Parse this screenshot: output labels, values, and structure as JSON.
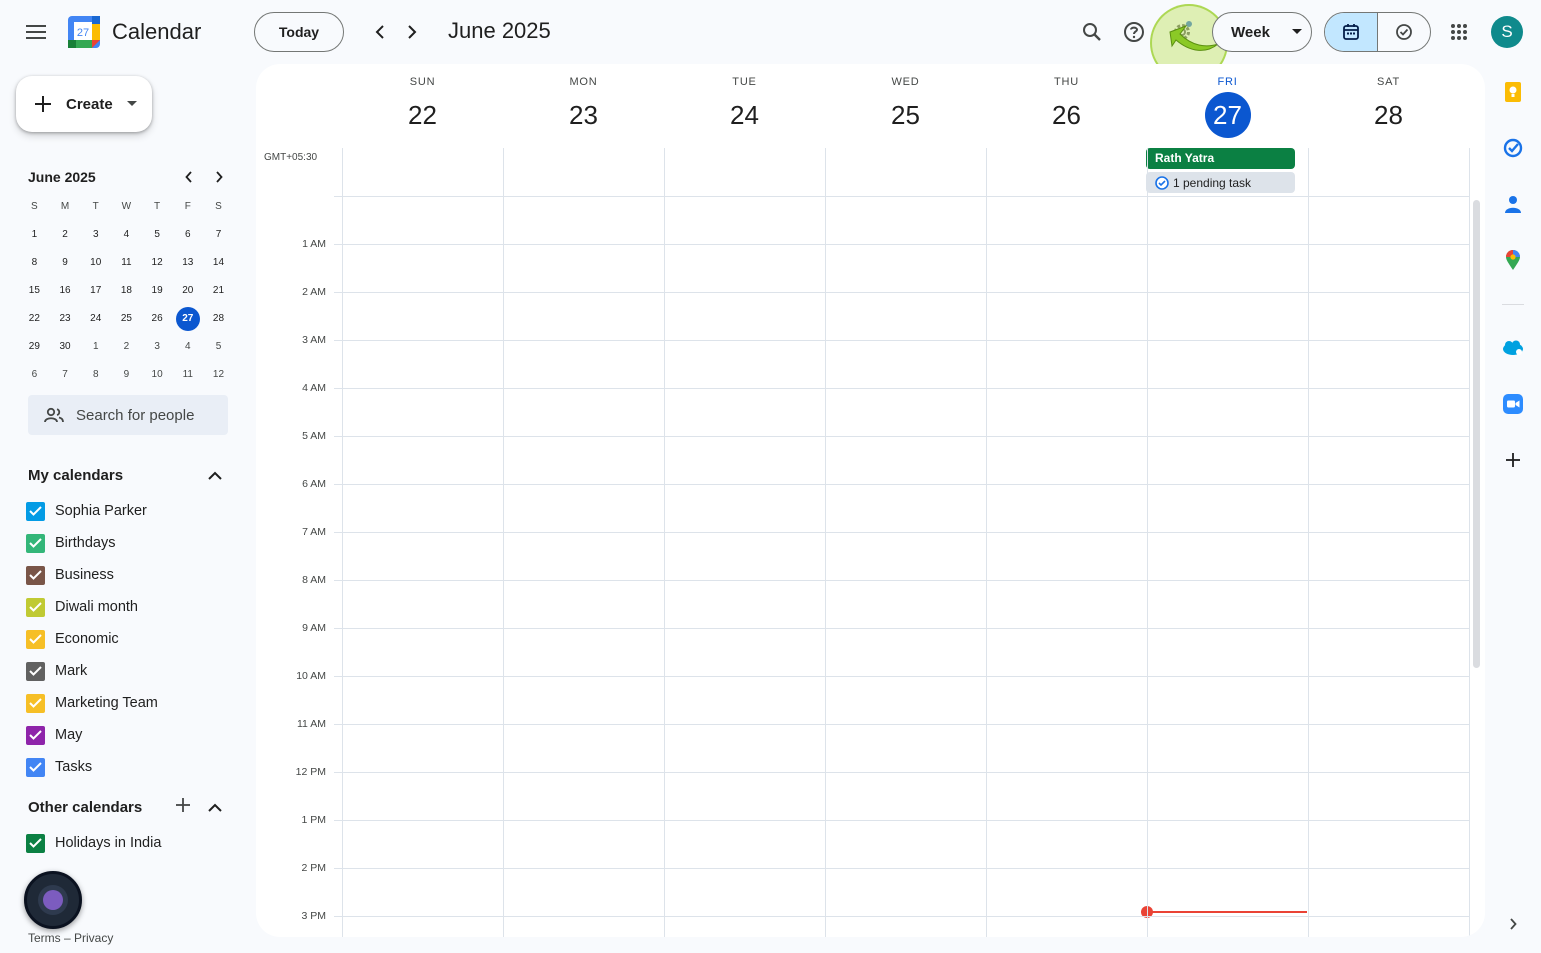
{
  "header": {
    "app_title": "Calendar",
    "logo_day": "27",
    "today_label": "Today",
    "month_title": "June 2025",
    "view_label": "Week",
    "avatar_letter": "S"
  },
  "sidebar": {
    "create_label": "Create",
    "mini_calendar": {
      "title": "June 2025",
      "weekdays": [
        "S",
        "M",
        "T",
        "W",
        "T",
        "F",
        "S"
      ],
      "weeks": [
        [
          "1",
          "2",
          "3",
          "4",
          "5",
          "6",
          "7"
        ],
        [
          "8",
          "9",
          "10",
          "11",
          "12",
          "13",
          "14"
        ],
        [
          "15",
          "16",
          "17",
          "18",
          "19",
          "20",
          "21"
        ],
        [
          "22",
          "23",
          "24",
          "25",
          "26",
          "27",
          "28"
        ],
        [
          "29",
          "30",
          "1",
          "2",
          "3",
          "4",
          "5"
        ],
        [
          "6",
          "7",
          "8",
          "9",
          "10",
          "11",
          "12"
        ]
      ],
      "today": "27"
    },
    "search_people_placeholder": "Search for people",
    "my_calendars_title": "My calendars",
    "my_calendars": [
      {
        "label": "Sophia Parker",
        "color": "#039be5"
      },
      {
        "label": "Birthdays",
        "color": "#33b679"
      },
      {
        "label": "Business",
        "color": "#795548"
      },
      {
        "label": "Diwali month",
        "color": "#c0ca33"
      },
      {
        "label": "Economic",
        "color": "#f6bf26"
      },
      {
        "label": "Mark",
        "color": "#616161"
      },
      {
        "label": "Marketing Team",
        "color": "#f6bf26"
      },
      {
        "label": "May",
        "color": "#8e24aa"
      },
      {
        "label": "Tasks",
        "color": "#4285f4"
      }
    ],
    "other_calendars_title": "Other calendars",
    "other_calendars": [
      {
        "label": "Holidays in India",
        "color": "#0b8043"
      }
    ],
    "footer": "Terms – Privacy"
  },
  "week": {
    "timezone": "GMT+05:30",
    "days": [
      {
        "name": "SUN",
        "num": "22"
      },
      {
        "name": "MON",
        "num": "23"
      },
      {
        "name": "TUE",
        "num": "24"
      },
      {
        "name": "WED",
        "num": "25"
      },
      {
        "name": "THU",
        "num": "26"
      },
      {
        "name": "FRI",
        "num": "27",
        "today": true
      },
      {
        "name": "SAT",
        "num": "28"
      }
    ],
    "hours": [
      "1 AM",
      "2 AM",
      "3 AM",
      "4 AM",
      "5 AM",
      "6 AM",
      "7 AM",
      "8 AM",
      "9 AM",
      "10 AM",
      "11 AM",
      "12 PM",
      "1 PM",
      "2 PM",
      "3 PM"
    ],
    "all_day_event": "Rath Yatra",
    "pending_task": "1 pending task"
  },
  "colors": {
    "accent": "#0b57d0",
    "event_green": "#0b8043",
    "now_line": "#ea4335"
  },
  "right_rail_icons": [
    "keep-icon",
    "tasks-icon",
    "contacts-icon",
    "maps-icon",
    "salesforce-icon",
    "zoom-icon",
    "add-addon-icon"
  ]
}
